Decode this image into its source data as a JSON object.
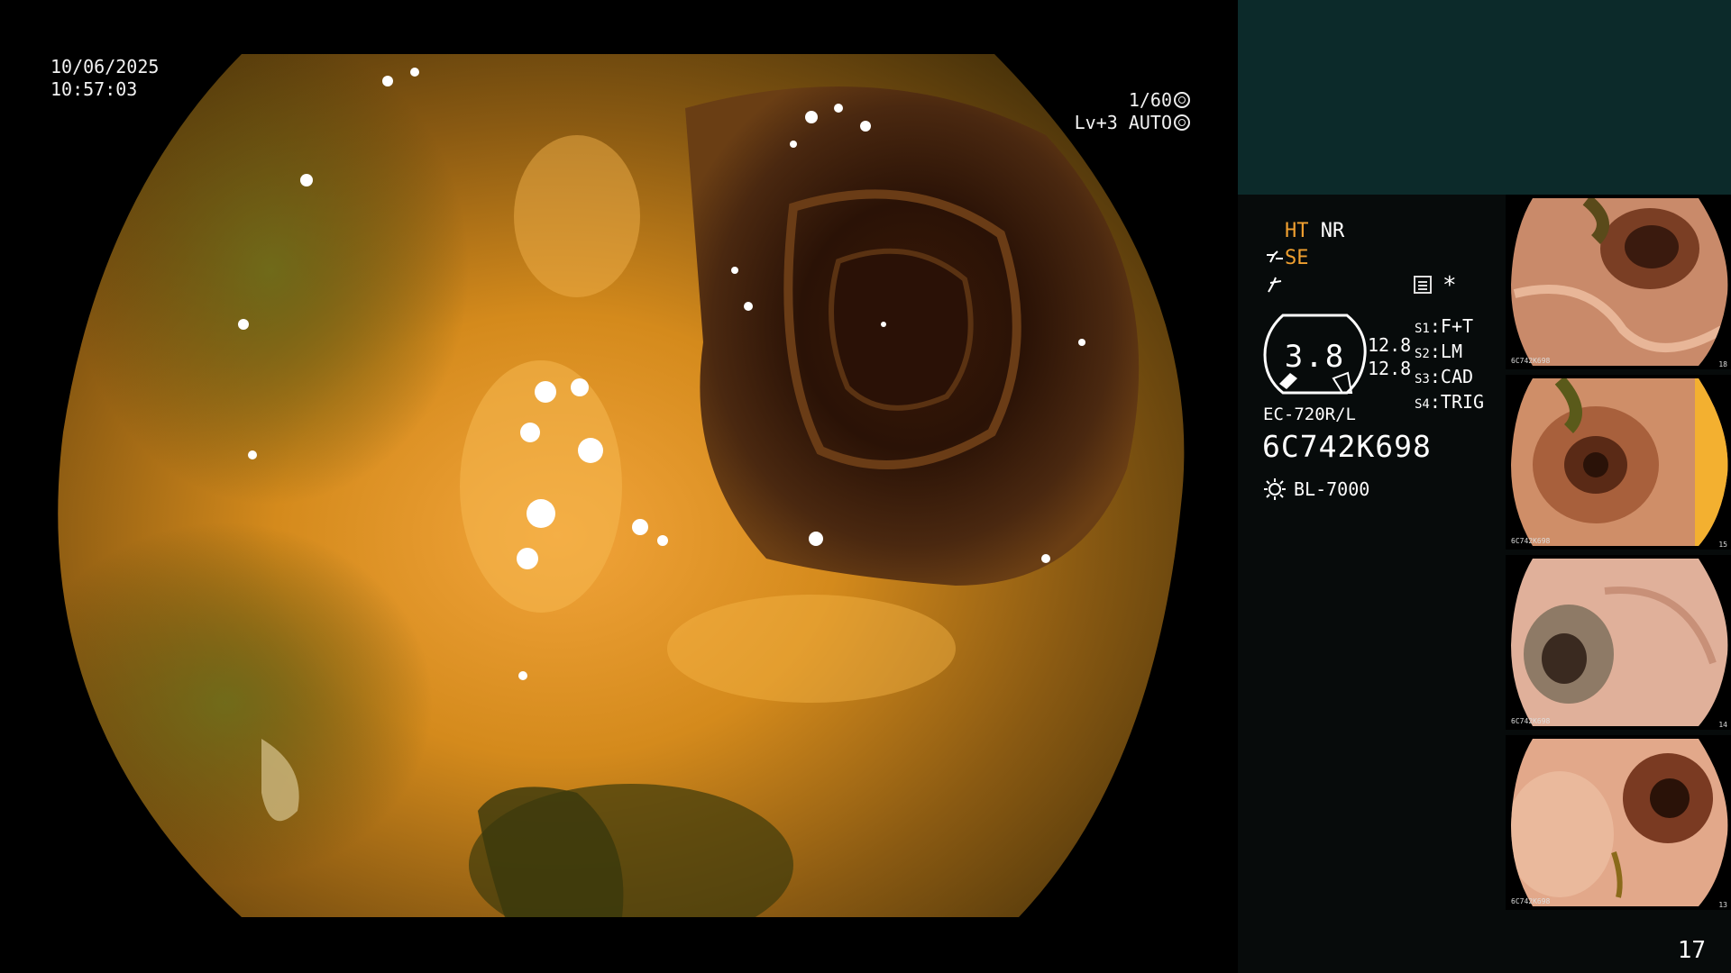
{
  "overlay": {
    "date": "10/06/2025",
    "time": "10:57:03",
    "shutter": "1/60",
    "iris": "Lv+3 AUTO"
  },
  "modes": {
    "ht": "HT",
    "nr": "NR",
    "se": "SE"
  },
  "gauge": {
    "value": "3.8",
    "side_top": "12.8",
    "side_bottom": "12.8"
  },
  "switches": [
    {
      "key": "S1",
      "value": "F+T"
    },
    {
      "key": "S2",
      "value": "LM"
    },
    {
      "key": "S3",
      "value": "CAD"
    },
    {
      "key": "S4",
      "value": "TRIG"
    }
  ],
  "scope": {
    "model": "EC-720R/L",
    "serial": "6C742K698",
    "light_source": "BL-7000"
  },
  "thumbnails": [
    {
      "serial": "6C742K698",
      "number": "18"
    },
    {
      "serial": "6C742K698",
      "number": "15"
    },
    {
      "serial": "6C742K698",
      "number": "14"
    },
    {
      "serial": "6C742K698",
      "number": "13"
    }
  ],
  "page_number": "17",
  "colors": {
    "panel_bg": "#070b0b",
    "preview_bg": "#0c2a2a",
    "mode_accent": "#f0a030"
  },
  "icons": [
    "shutter-icon",
    "auto-iris-icon",
    "structure-enhance-icon",
    "color-enhance-icon",
    "settings-icon",
    "light-source-icon"
  ]
}
